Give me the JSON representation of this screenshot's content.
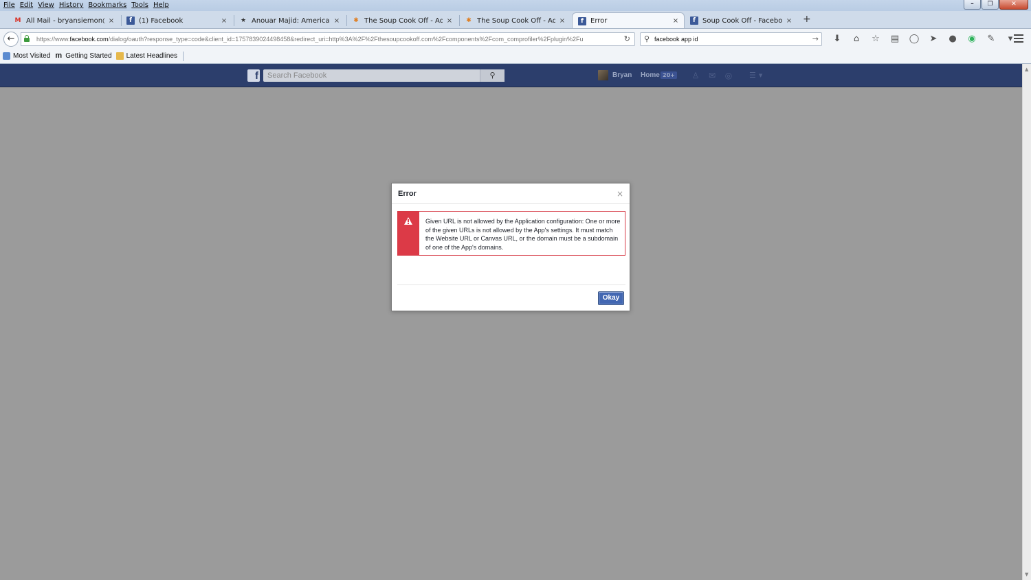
{
  "menu": [
    "File",
    "Edit",
    "View",
    "History",
    "Bookmarks",
    "Tools",
    "Help"
  ],
  "window_controls": {
    "minimize": "–",
    "restore": "❐",
    "close": "✕"
  },
  "tabs": [
    {
      "label": "All Mail - bryansiemon@g...",
      "icon": "gmail-icon",
      "glyph": "M",
      "close": "×"
    },
    {
      "label": "(1) Facebook",
      "icon": "facebook-icon",
      "glyph": "f",
      "close": "×"
    },
    {
      "label": "Anouar Majid: America's T...",
      "icon": "star-icon",
      "glyph": "★",
      "close": "×"
    },
    {
      "label": "The Soup Cook Off - Admi...",
      "icon": "joomla-icon",
      "glyph": "✱",
      "close": "×"
    },
    {
      "label": "The Soup Cook Off - Admi...",
      "icon": "joomla-icon",
      "glyph": "✱",
      "close": "×"
    },
    {
      "label": "Error",
      "icon": "facebook-icon",
      "glyph": "f",
      "close": "×"
    },
    {
      "label": "Soup Cook Off - Facebook ...",
      "icon": "facebook-icon",
      "glyph": "f",
      "close": "×"
    }
  ],
  "new_tab": "+",
  "address": {
    "prefix": "https://www.",
    "domain": "facebook.com",
    "rest": "/dialog/oauth?response_type=code&client_id=1757839024498458&redirect_uri=http%3A%2F%2Fthesoupcookoff.com%2Fcomponents%2Fcom_comprofiler%2Fplugin%2Fu"
  },
  "search": {
    "value": "facebook app id"
  },
  "bookmarks": [
    {
      "label": "Most Visited"
    },
    {
      "label": "Getting Started"
    },
    {
      "label": "Latest Headlines"
    }
  ],
  "fb": {
    "logo": "f",
    "search_placeholder": "Search Facebook",
    "user_name": "Bryan",
    "home_label": "Home",
    "home_badge": "20+"
  },
  "dialog": {
    "title": "Error",
    "close": "×",
    "message": "Given URL is not allowed by the Application configuration: One or more of the given URLs is not allowed by the App's settings. It must match the Website URL or Canvas URL, or the domain must be a subdomain of one of the App's domains.",
    "button": "Okay"
  },
  "colors": {
    "fb_header": "#2c3e6c",
    "error_red": "#dc3a47",
    "button_blue": "#4267b2"
  }
}
